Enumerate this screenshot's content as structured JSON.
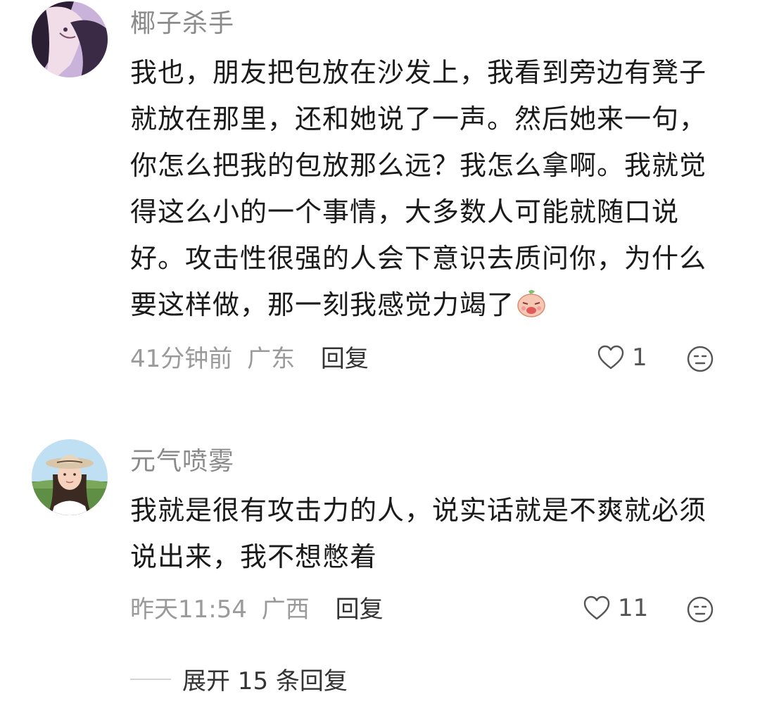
{
  "comments": [
    {
      "username": "椰子杀手",
      "text": "我也，朋友把包放在沙发上，我看到旁边有凳子就放在那里，还和她说了一声。然后她来一句，你怎么把我的包放那么远？我怎么拿啊。我就觉得这么小的一个事情，大多数人可能就随口说好。攻击性很强的人会下意识去质问你，为什么要这样做，那一刻我感觉力竭了",
      "time": "41分钟前",
      "location": "广东",
      "reply_label": "回复",
      "likes": "1",
      "avatar_icon": "avatar-anime-girl-icon",
      "emoji_icon": "exhausted-emoji-icon"
    },
    {
      "username": "元气喷雾",
      "text": "我就是很有攻击力的人，说实话就是不爽就必须说出来，我不想憋着",
      "time": "昨天11:54",
      "location": "广西",
      "reply_label": "回复",
      "likes": "11",
      "avatar_icon": "avatar-hat-girl-icon"
    }
  ],
  "expand_replies": "展开 15 条回复",
  "colors": {
    "username": "#8a8a8a",
    "meta": "#9a9a9a",
    "text": "#1a1a1a",
    "icon": "#555555"
  }
}
